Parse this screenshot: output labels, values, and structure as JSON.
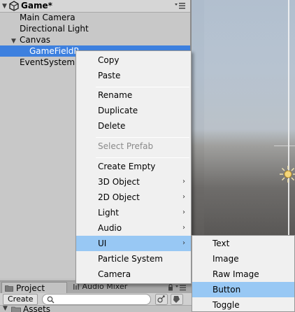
{
  "hierarchy": {
    "scene_title": "Game*",
    "items": [
      {
        "label": "Main Camera"
      },
      {
        "label": "Directional Light"
      },
      {
        "label": "Canvas"
      },
      {
        "label": "GameFieldP"
      },
      {
        "label": "EventSystem"
      }
    ]
  },
  "context_menu": {
    "items": [
      {
        "label": "Copy"
      },
      {
        "label": "Paste"
      },
      {
        "label": "Rename"
      },
      {
        "label": "Duplicate"
      },
      {
        "label": "Delete"
      },
      {
        "label": "Select Prefab",
        "disabled": true
      },
      {
        "label": "Create Empty"
      },
      {
        "label": "3D Object",
        "submenu": true
      },
      {
        "label": "2D Object",
        "submenu": true
      },
      {
        "label": "Light",
        "submenu": true
      },
      {
        "label": "Audio",
        "submenu": true
      },
      {
        "label": "UI",
        "submenu": true,
        "highlighted": true
      },
      {
        "label": "Particle System"
      },
      {
        "label": "Camera"
      }
    ],
    "arrow_glyph": "›"
  },
  "ui_submenu": {
    "items": [
      {
        "label": "Text"
      },
      {
        "label": "Image"
      },
      {
        "label": "Raw Image"
      },
      {
        "label": "Button",
        "highlighted": true
      },
      {
        "label": "Toggle"
      }
    ]
  },
  "project": {
    "tab_label": "Project",
    "mixer_tab_label": "Audio Mixer",
    "create_label": "Create",
    "create_arrow": "▾",
    "assets_label": "Assets"
  },
  "colors": {
    "selection": "#3d80df",
    "menu_highlight": "#98c8f4",
    "menu_background": "#f0f0f0"
  },
  "icons": [
    "unity-scene-icon",
    "panel-menu-icon",
    "sun-icon",
    "folder-icon",
    "audio-mixer-icon",
    "lock-icon",
    "search-icon",
    "label-icon",
    "bookmark-icon"
  ]
}
